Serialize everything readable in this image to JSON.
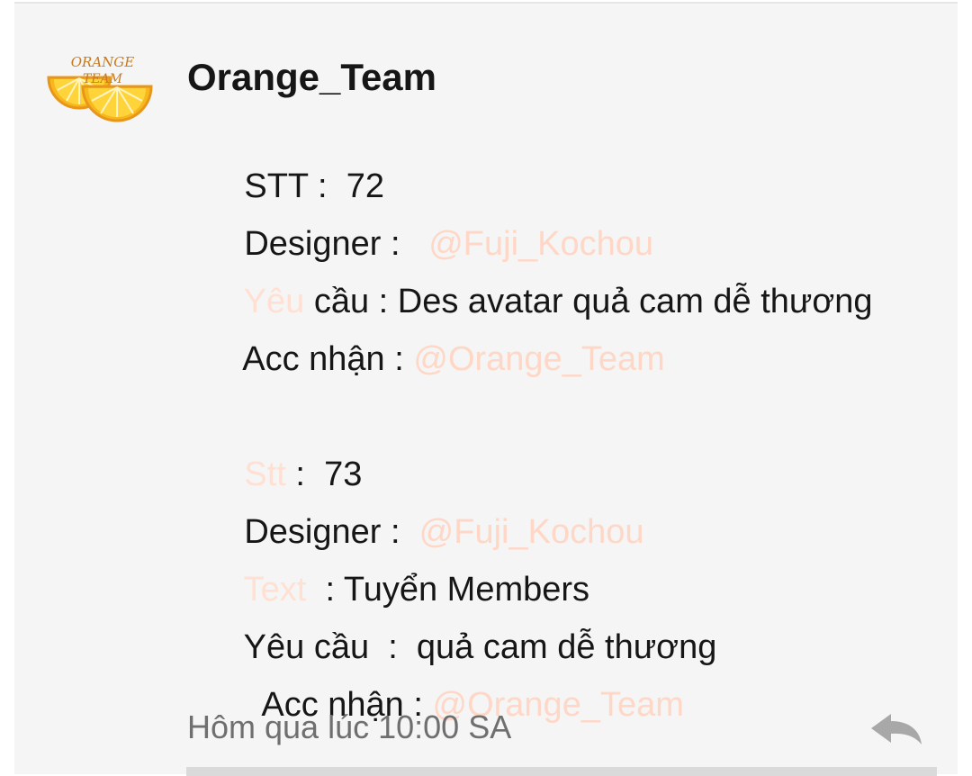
{
  "post": {
    "author": "Orange_Team",
    "avatar_text_1": "ORANGE",
    "avatar_text_2": "TEAM",
    "timestamp": "Hôm qua lúc 10:00 SA"
  },
  "lines": [
    {
      "label": "STT :  ",
      "value": "72"
    },
    {
      "label": "Designer :   ",
      "mention": "@Fuji_Kochou"
    },
    {
      "faded": "Yêu",
      "label": " cầu : ",
      "value": "Des avatar quả cam dễ thương"
    },
    {
      "label": "Acc nhận : ",
      "mention": "@Orange_Team"
    },
    {
      "faded": "Stt",
      "label": " :  ",
      "value": "73"
    },
    {
      "label": "Designer :  ",
      "mention": "@Fuji_Kochou"
    },
    {
      "faded": "Text",
      "label": "  : ",
      "value": "Tuyển Members"
    },
    {
      "label": "Yêu cầu  :  ",
      "value": "quả cam dễ thương"
    },
    {
      "label": "  Acc nhận : ",
      "mention": "@Orange_Team"
    }
  ],
  "icons": {
    "reply": "reply-arrow-icon",
    "avatar": "orange-slices-logo"
  },
  "colors": {
    "background": "#f5f5f5",
    "text": "#161616",
    "mention": "#ffd7c6",
    "timestamp": "#6f6f6f"
  }
}
